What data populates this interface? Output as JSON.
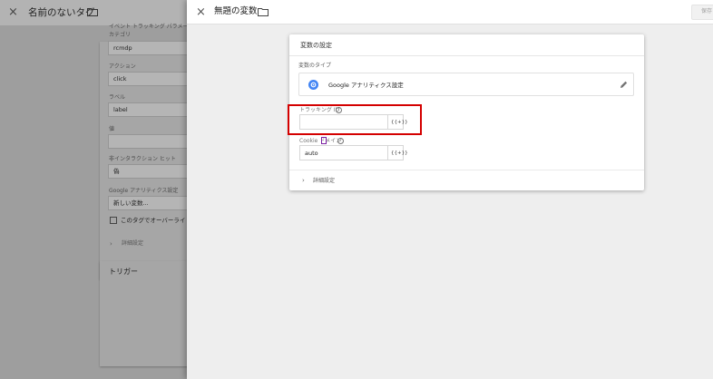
{
  "background_tag": {
    "title": "名前のないタグ",
    "close_label": "×",
    "fields": [
      {
        "label": "イベント トラッキング パラメータ",
        "value": null
      },
      {
        "label": "カテゴリ",
        "value": "rcmdp"
      },
      {
        "label": "アクション",
        "value": "click"
      },
      {
        "label": "ラベル",
        "value": "label"
      },
      {
        "label": "値",
        "value": ""
      },
      {
        "label": "非インタラクション ヒット",
        "value": "偽"
      },
      {
        "label": "Google アナリティクス設定",
        "value": "新しい変数..."
      }
    ],
    "override_label": "このタグでオーバーライド設",
    "advanced_label": "詳細設定",
    "trigger_title": "トリガー"
  },
  "panel": {
    "close_label": "×",
    "title": "無題の変数",
    "save_label": "保存",
    "card": {
      "title": "変数の設定",
      "variable_type_label": "変数のタイプ",
      "variable_type_name": "Google アナリティクス設定",
      "tracking_id": {
        "label": "トラッキング ID",
        "value": "",
        "picker_label": "{{+}}"
      },
      "cookie_domain": {
        "label": "Cookie ドメイン",
        "value": "auto",
        "picker_label": "{{+}}"
      },
      "advanced_label": "詳細設定"
    }
  },
  "icons": {
    "close": "close-icon",
    "folder": "folder-icon",
    "analytics": "google-analytics-settings-icon",
    "edit": "pencil-icon",
    "help": "help-icon",
    "chevron": "chevron-right-icon"
  },
  "colors": {
    "highlight": "#d40000",
    "analytics_icon": "#4285f4",
    "overlay": "#9e9e9e"
  }
}
